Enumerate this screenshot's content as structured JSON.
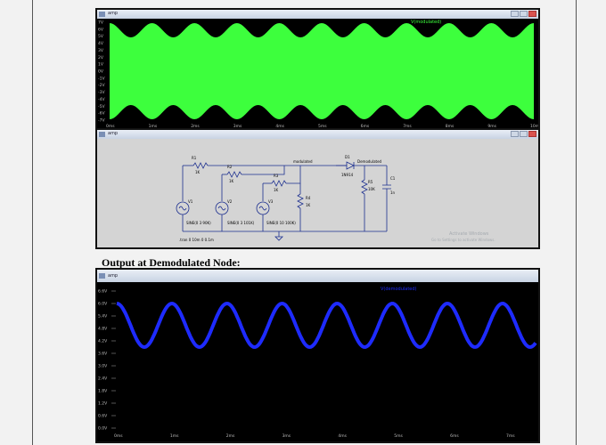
{
  "top_window": {
    "title": "amp",
    "trace_title": "V(modulated)",
    "y_ticks": [
      "7V",
      "6V",
      "5V",
      "4V",
      "3V",
      "2V",
      "1V",
      "0V",
      "-1V",
      "-2V",
      "-3V",
      "-4V",
      "-5V",
      "-6V",
      "-7V"
    ],
    "x_ticks": [
      "0ms",
      "1ms",
      "2ms",
      "3ms",
      "4ms",
      "5ms",
      "6ms",
      "7ms",
      "8ms",
      "9ms",
      "10ms"
    ],
    "trace_color": "#3dff3d"
  },
  "schematic_window": {
    "title": "amp",
    "labels": {
      "r1": "R1",
      "r1_val": "1K",
      "r2": "R2",
      "r2_val": "1K",
      "r3": "R3",
      "r3_val": "1K",
      "r4": "R4",
      "r4_val": "1K",
      "r5": "R5",
      "r5_val": "10K",
      "c1": "C1",
      "c1_val": "1n",
      "d1": "D1",
      "d1_val": "1N914",
      "v1": "V1",
      "v1_val": "SINE(0 3 90K)",
      "v2": "V2",
      "v2_val": "SINE(0 3 101K)",
      "v3": "V3",
      "v3_val": "SINE(0 10 100K)",
      "modulated_node": "modulated",
      "demodulated_node": "Demodulated",
      "tran": ".tran 0 10m 0 0.1m",
      "watermark1": "Activate Windows",
      "watermark2": "Go to Settings to activate Windows."
    }
  },
  "caption": "Output at Demodulated Node:",
  "bottom_window": {
    "title": "amp",
    "trace_title": "V(demodulated)",
    "y_ticks": [
      "6.6V",
      "6.0V",
      "5.4V",
      "4.8V",
      "4.2V",
      "3.6V",
      "3.0V",
      "2.4V",
      "1.8V",
      "1.2V",
      "0.6V",
      "0.0V"
    ],
    "x_ticks": [
      "0ms",
      "1ms",
      "2ms",
      "3ms",
      "4ms",
      "5ms",
      "6ms",
      "7ms"
    ],
    "trace_color": "#1e2bff"
  }
}
